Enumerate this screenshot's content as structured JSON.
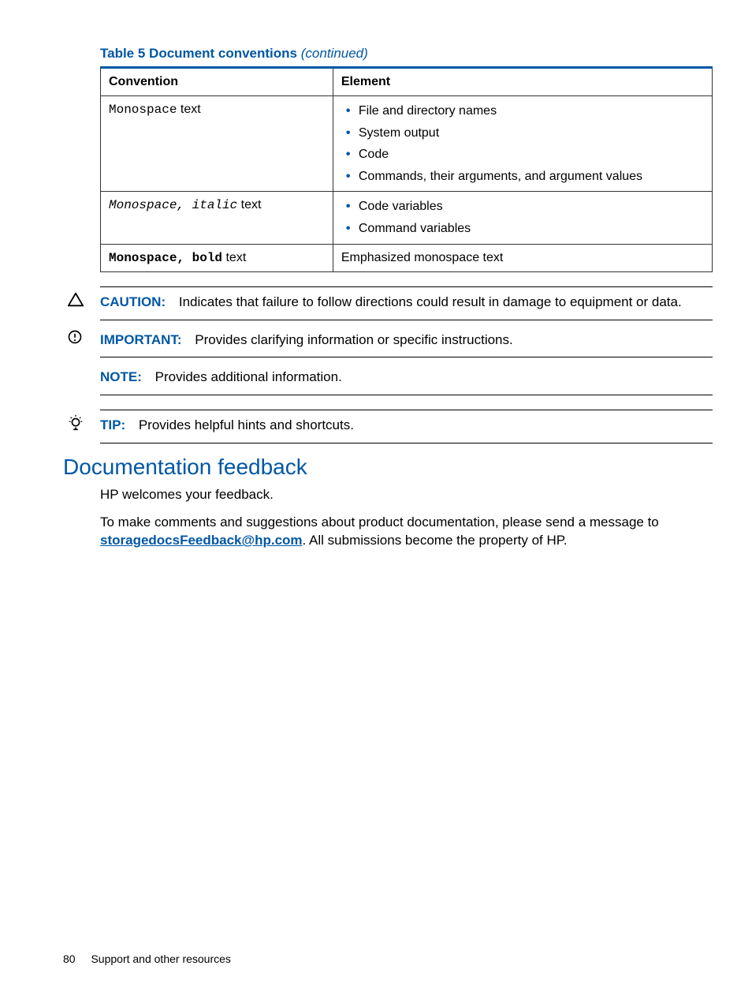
{
  "table": {
    "caption_bold": "Table 5 Document conventions",
    "caption_italic": "(continued)",
    "headers": {
      "col1": "Convention",
      "col2": "Element"
    },
    "rows": [
      {
        "conv_mono": "Monospace",
        "conv_suffix": " text",
        "elements": [
          "File and directory names",
          "System output",
          "Code",
          "Commands, their arguments, and argument values"
        ]
      },
      {
        "conv_mono": "Monospace, italic",
        "conv_suffix": " text",
        "elements": [
          "Code variables",
          "Command variables"
        ]
      },
      {
        "conv_mono": "Monospace, bold",
        "conv_suffix": " text",
        "element_plain": "Emphasized monospace text"
      }
    ]
  },
  "admon": {
    "caution_label": "CAUTION:",
    "caution_text": "Indicates that failure to follow directions could result in damage to equipment or data.",
    "important_label": "IMPORTANT:",
    "important_text": "Provides clarifying information or specific instructions.",
    "note_label": "NOTE:",
    "note_text": "Provides additional information.",
    "tip_label": "TIP:",
    "tip_text": "Provides helpful hints and shortcuts."
  },
  "section": {
    "heading": "Documentation feedback",
    "p1": "HP welcomes your feedback.",
    "p2_pre": "To make comments and suggestions about product documentation, please send a message to ",
    "p2_link": "storagedocsFeedback@hp.com",
    "p2_post": ". All submissions become the property of HP."
  },
  "footer": {
    "page": "80",
    "title": "Support and other resources"
  }
}
